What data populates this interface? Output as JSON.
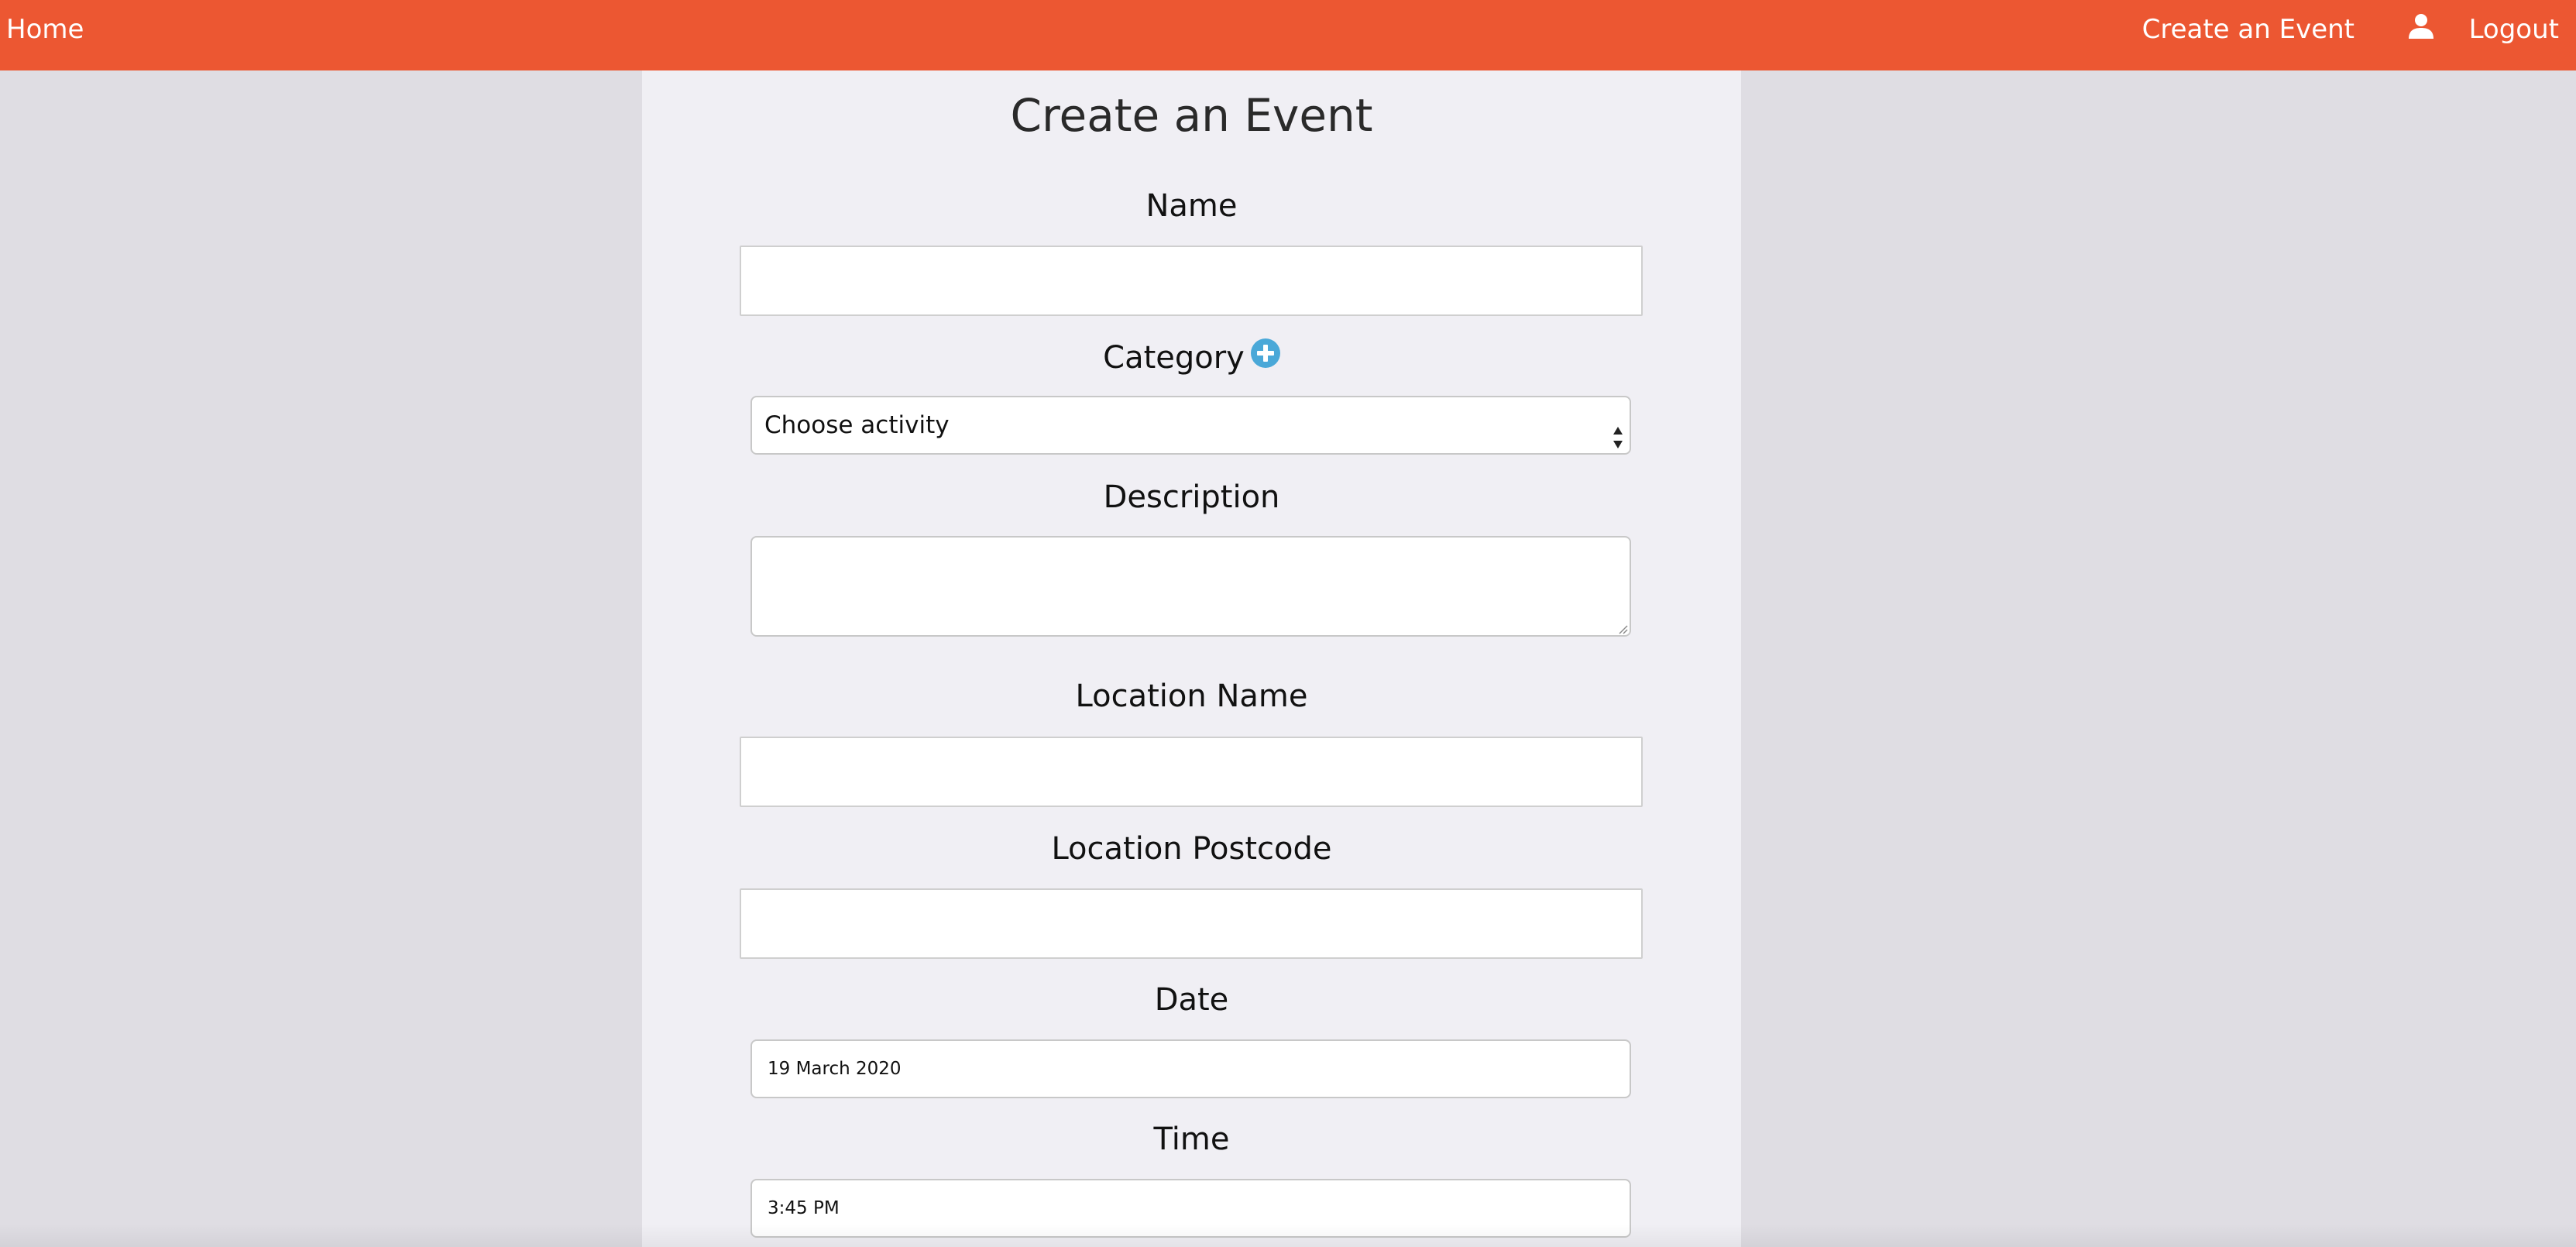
{
  "navbar": {
    "home_label": "Home",
    "create_event_label": "Create an Event",
    "logout_label": "Logout",
    "user_icon": "user-icon",
    "background_color": "#ec5732"
  },
  "page": {
    "title": "Create an Event"
  },
  "form": {
    "name": {
      "label": "Name",
      "value": ""
    },
    "category": {
      "label": "Category",
      "add_icon": "plus-circle-icon",
      "selected_option": "Choose activity"
    },
    "description": {
      "label": "Description",
      "value": ""
    },
    "location_name": {
      "label": "Location Name",
      "value": ""
    },
    "location_postcode": {
      "label": "Location Postcode",
      "value": ""
    },
    "date": {
      "label": "Date",
      "value": "19 March 2020"
    },
    "time": {
      "label": "Time",
      "value": "3:45 PM"
    }
  },
  "colors": {
    "accent": "#ec5732",
    "page_background": "#dfdde3",
    "panel_background": "#f0eff4",
    "add_icon": "#4aa8d8"
  }
}
